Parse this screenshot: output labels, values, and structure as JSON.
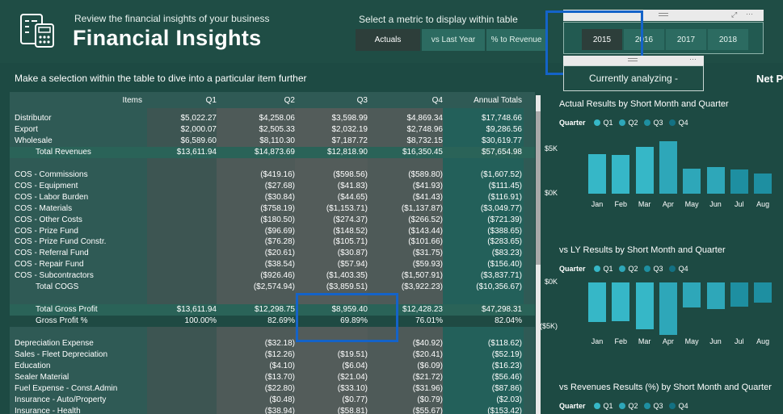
{
  "header": {
    "subtitle": "Review the financial insights of your business",
    "title": "Financial Insights",
    "metric_label": "Select a metric to display within table",
    "metric_buttons": [
      {
        "label": "Actuals",
        "active": true
      },
      {
        "label": "vs Last Year",
        "active": false
      },
      {
        "label": "% to Revenue",
        "active": false
      }
    ]
  },
  "year_slicer": {
    "years": [
      {
        "label": "2015",
        "active": true
      },
      {
        "label": "2016",
        "active": false
      },
      {
        "label": "2017",
        "active": false
      },
      {
        "label": "2018",
        "active": false
      }
    ],
    "more_glyph": "···",
    "focus_glyph": "⤢"
  },
  "analyzing": {
    "label": "Currently analyzing -",
    "net_label": "Net P"
  },
  "instruction": "Make a selection within the table to dive into a particular item further",
  "table": {
    "columns": [
      "Items",
      "Q1",
      "Q2",
      "Q3",
      "Q4",
      "Annual Totals"
    ],
    "rows": [
      {
        "label": "Distributor",
        "values": [
          "$5,022.27",
          "$4,258.06",
          "$3,598.99",
          "$4,869.34",
          "$17,748.66"
        ]
      },
      {
        "label": "Export",
        "values": [
          "$2,000.07",
          "$2,505.33",
          "$2,032.19",
          "$2,748.96",
          "$9,286.56"
        ]
      },
      {
        "label": "Wholesale",
        "values": [
          "$6,589.60",
          "$8,110.30",
          "$7,187.72",
          "$8,732.15",
          "$30,619.77"
        ]
      },
      {
        "label": "Total Revenues",
        "values": [
          "$13,611.94",
          "$14,873.69",
          "$12,818.90",
          "$16,350.45",
          "$57,654.98"
        ],
        "style": "total"
      },
      {
        "label": "",
        "values": [
          "",
          "",
          "",
          "",
          ""
        ]
      },
      {
        "label": "COS - Commissions",
        "values": [
          "",
          "($419.16)",
          "($598.56)",
          "($589.80)",
          "($1,607.52)"
        ]
      },
      {
        "label": "COS - Equipment",
        "values": [
          "",
          "($27.68)",
          "($41.83)",
          "($41.93)",
          "($111.45)"
        ]
      },
      {
        "label": "COS - Labor Burden",
        "values": [
          "",
          "($30.84)",
          "($44.65)",
          "($41.43)",
          "($116.91)"
        ]
      },
      {
        "label": "COS - Materials",
        "values": [
          "",
          "($758.19)",
          "($1,153.71)",
          "($1,137.87)",
          "($3,049.77)"
        ]
      },
      {
        "label": "COS - Other Costs",
        "values": [
          "",
          "($180.50)",
          "($274.37)",
          "($266.52)",
          "($721.39)"
        ]
      },
      {
        "label": "COS - Prize Fund",
        "values": [
          "",
          "($96.69)",
          "($148.52)",
          "($143.44)",
          "($388.65)"
        ]
      },
      {
        "label": "COS - Prize Fund Constr.",
        "values": [
          "",
          "($76.28)",
          "($105.71)",
          "($101.66)",
          "($283.65)"
        ]
      },
      {
        "label": "COS - Referral Fund",
        "values": [
          "",
          "($20.61)",
          "($30.87)",
          "($31.75)",
          "($83.23)"
        ]
      },
      {
        "label": "COS - Repair Fund",
        "values": [
          "",
          "($38.54)",
          "($57.94)",
          "($59.93)",
          "($156.40)"
        ]
      },
      {
        "label": "COS - Subcontractors",
        "values": [
          "",
          "($926.46)",
          "($1,403.35)",
          "($1,507.91)",
          "($3,837.71)"
        ]
      },
      {
        "label": "Total COGS",
        "values": [
          "",
          "($2,574.94)",
          "($3,859.51)",
          "($3,922.23)",
          "($10,356.67)"
        ],
        "style": "indent"
      },
      {
        "label": "",
        "values": [
          "",
          "",
          "",
          "",
          ""
        ]
      },
      {
        "label": "Total Gross Profit",
        "values": [
          "$13,611.94",
          "$12,298.75",
          "$8,959.40",
          "$12,428.23",
          "$47,298.31"
        ],
        "style": "total-indent"
      },
      {
        "label": "Gross Profit %",
        "values": [
          "100.00%",
          "82.69%",
          "69.89%",
          "76.01%",
          "82.04%"
        ],
        "style": "gp"
      },
      {
        "label": "",
        "values": [
          "",
          "",
          "",
          "",
          ""
        ]
      },
      {
        "label": "Depreciation Expense",
        "values": [
          "",
          "($32.18)",
          "",
          "($40.92)",
          "($118.62)"
        ]
      },
      {
        "label": "Sales - Fleet Depreciation",
        "values": [
          "",
          "($12.26)",
          "($19.51)",
          "($20.41)",
          "($52.19)"
        ]
      },
      {
        "label": "Education",
        "values": [
          "",
          "($4.10)",
          "($6.04)",
          "($6.09)",
          "($16.23)"
        ]
      },
      {
        "label": "Sealer Material",
        "values": [
          "",
          "($13.70)",
          "($21.04)",
          "($21.72)",
          "($56.46)"
        ]
      },
      {
        "label": "Fuel Expense - Const.Admin",
        "values": [
          "",
          "($22.80)",
          "($33.10)",
          "($31.96)",
          "($87.86)"
        ]
      },
      {
        "label": "Insurance - Auto/Property",
        "values": [
          "",
          "($0.48)",
          "($0.77)",
          "($0.79)",
          "($2.03)"
        ]
      },
      {
        "label": "Insurance - Health",
        "values": [
          "",
          "($38.94)",
          "($58.81)",
          "($55.67)",
          "($153.42)"
        ]
      }
    ]
  },
  "charts": [
    {
      "type": "bar",
      "title": "Actual Results by Short Month and Quarter",
      "legend_title": "Quarter",
      "series": [
        {
          "name": "Q1",
          "color": "#36b7c7"
        },
        {
          "name": "Q2",
          "color": "#2ea7b9"
        },
        {
          "name": "Q3",
          "color": "#1e8fa1"
        },
        {
          "name": "Q4",
          "color": "#137183"
        }
      ],
      "categories": [
        "Jan",
        "Feb",
        "Mar",
        "Apr",
        "May",
        "Jun",
        "Jul",
        "Aug"
      ],
      "values": [
        4400,
        4300,
        5200,
        5900,
        2800,
        3000,
        2700,
        2300
      ],
      "quarter_index": [
        0,
        0,
        0,
        1,
        1,
        1,
        2,
        2
      ],
      "yticks": [
        {
          "v": 5000,
          "label": "$5K"
        },
        {
          "v": 0,
          "label": "$0K"
        }
      ],
      "ylim": [
        0,
        6500
      ]
    },
    {
      "type": "bar",
      "title": "vs LY Results by Short Month and Quarter",
      "legend_title": "Quarter",
      "series": [
        {
          "name": "Q1",
          "color": "#36b7c7"
        },
        {
          "name": "Q2",
          "color": "#2ea7b9"
        },
        {
          "name": "Q3",
          "color": "#1e8fa1"
        },
        {
          "name": "Q4",
          "color": "#137183"
        }
      ],
      "categories": [
        "Jan",
        "Feb",
        "Mar",
        "Apr",
        "May",
        "Jun",
        "Jul",
        "Aug"
      ],
      "values": [
        -4400,
        -4300,
        -5200,
        -5900,
        -2800,
        -3000,
        -2700,
        -2300
      ],
      "quarter_index": [
        0,
        0,
        0,
        1,
        1,
        1,
        2,
        2
      ],
      "yticks": [
        {
          "v": 0,
          "label": "$0K"
        },
        {
          "v": -5000,
          "label": "($5K)"
        }
      ],
      "ylim": [
        -6500,
        0
      ]
    },
    {
      "type": "bar",
      "title": "vs Revenues Results (%) by Short Month and Quarter",
      "legend_title": "Quarter",
      "series": [
        {
          "name": "Q1",
          "color": "#36b7c7"
        },
        {
          "name": "Q2",
          "color": "#2ea7b9"
        },
        {
          "name": "Q3",
          "color": "#1e8fa1"
        },
        {
          "name": "Q4",
          "color": "#137183"
        }
      ],
      "categories": [],
      "values": []
    }
  ]
}
